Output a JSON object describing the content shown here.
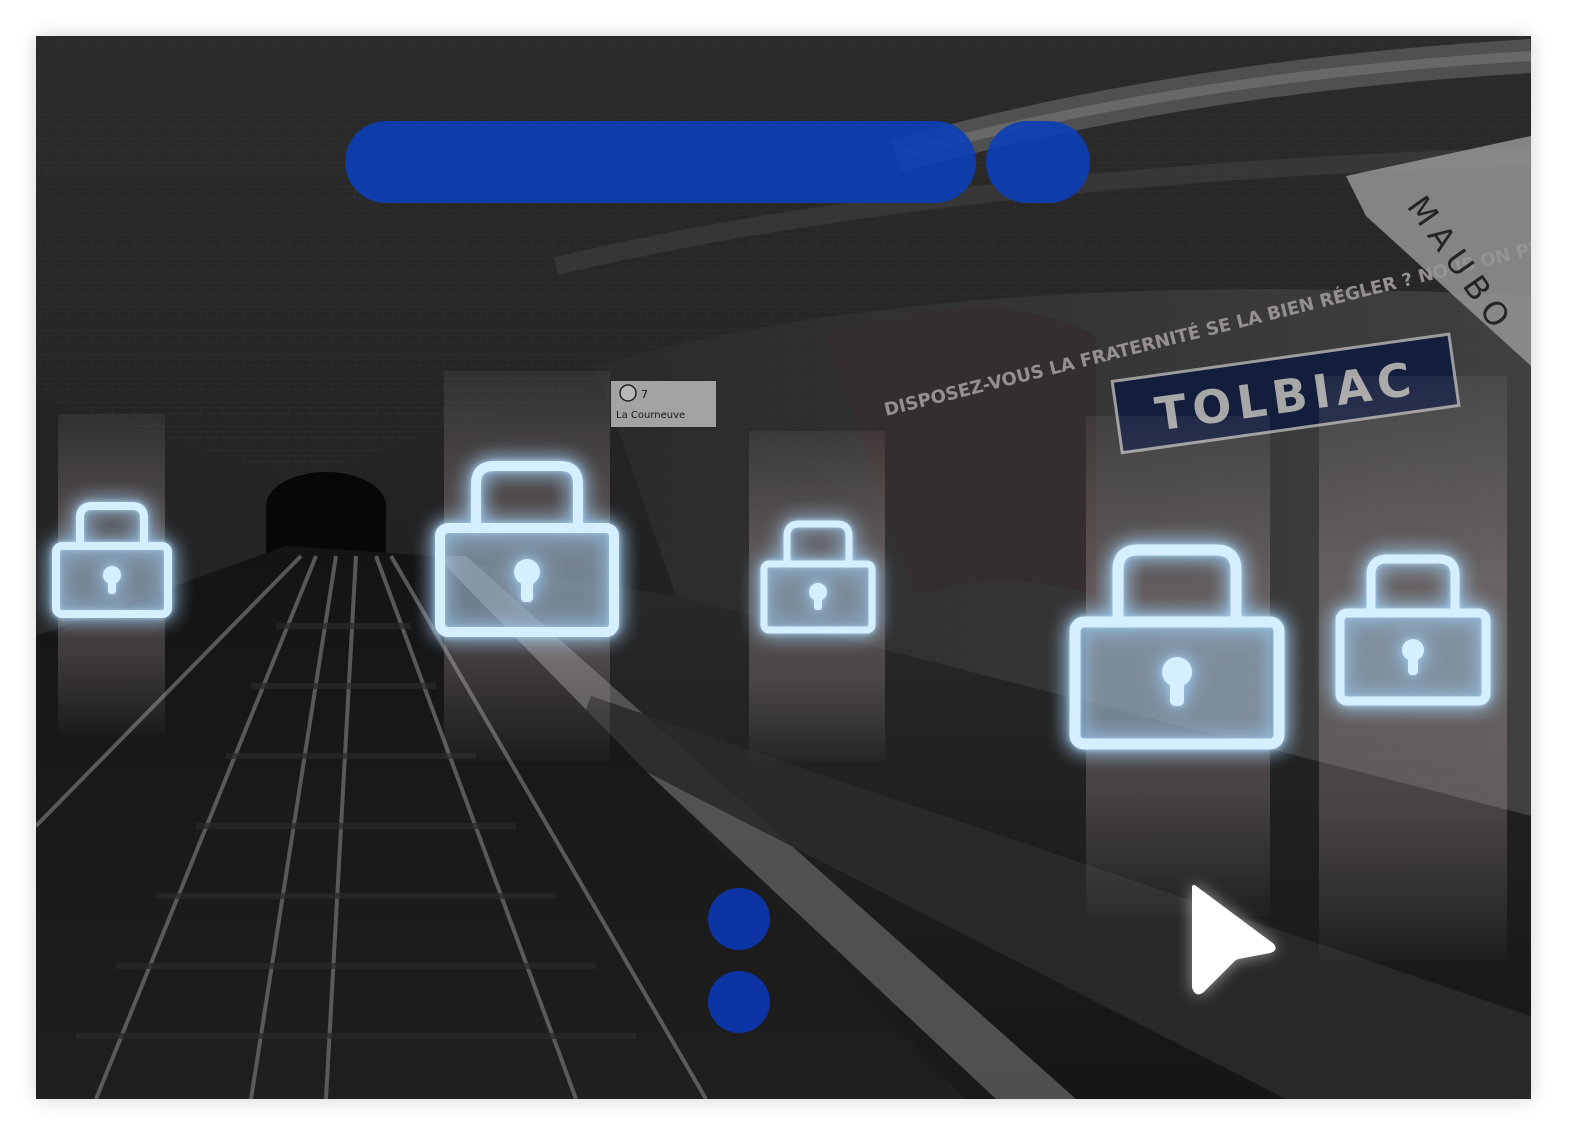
{
  "scene": {
    "station_sign": "TOLBIAC",
    "side_sign": "MAUBO",
    "line_sign": "La Courneuve",
    "line_number": "7",
    "poster_text": "DISPOSEZ-VOUS LA FRATERNITÉ SE LA BIEN RÉGLER ? NOUS ON PROPOSE JUSTE UN TRUC : ET SI ON ESSAYAIT ?"
  },
  "icons": {
    "lock": "lock-icon",
    "cursor": "mouse-pointer-icon"
  },
  "colors": {
    "accent": "#0b3fb8",
    "lock_glow": "#a9d8ff",
    "background": "#262626"
  }
}
